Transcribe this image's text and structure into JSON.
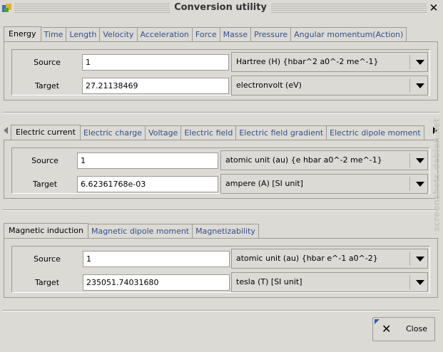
{
  "window": {
    "title": "Conversion utility",
    "app_icon": "app-icon",
    "close_icon": "close-icon"
  },
  "group1": {
    "tabs": [
      "Energy",
      "Time",
      "Length",
      "Velocity",
      "Acceleration",
      "Force",
      "Masse",
      "Pressure",
      "Angular momentum(Action)"
    ],
    "active_tab": "Energy",
    "source_label": "Source",
    "target_label": "Target",
    "source_value": "1",
    "target_value": "27.21138469",
    "source_unit": "Hartree (H) {hbar^2 a0^-2 me^-1}",
    "target_unit": "electronvolt (eV)"
  },
  "group2": {
    "tabs": [
      "Electric current",
      "Electric charge",
      "Voltage",
      "Electric field",
      "Electric field gradient",
      "Electric dipole moment"
    ],
    "active_tab": "Electric current",
    "source_label": "Source",
    "target_label": "Target",
    "source_value": "1",
    "target_value": "6.62361768e-03",
    "source_unit": "atomic unit (au) {e hbar a0^-2 me^-1}",
    "target_unit": "ampere (A) [SI unit]"
  },
  "group3": {
    "tabs": [
      "Magnetic induction",
      "Magnetic dipole moment",
      "Magnetizability"
    ],
    "active_tab": "Magnetic induction",
    "source_label": "Source",
    "target_label": "Target",
    "source_value": "1",
    "target_value": "235051.74031680",
    "source_unit": "atomic unit (au) {hbar e^-1 a0^-2}",
    "target_unit": "tesla (T) [SI unit]"
  },
  "footer": {
    "close_label": "Close",
    "close_icon": "x-icon"
  },
  "watermark": "screenshots.debian.net"
}
